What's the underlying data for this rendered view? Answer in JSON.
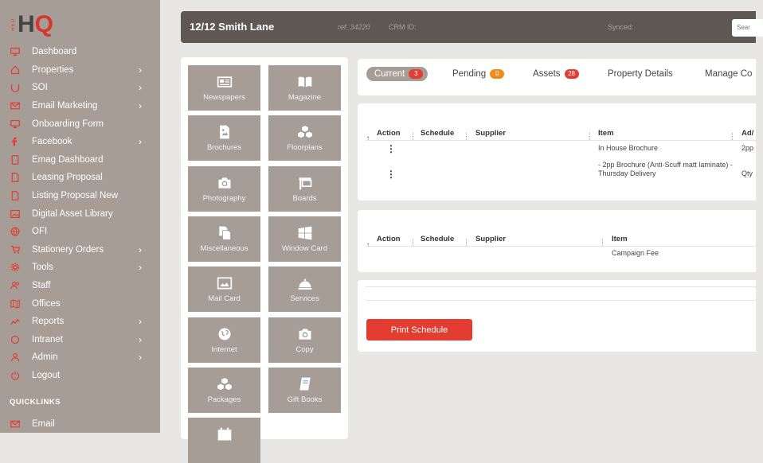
{
  "sidebar": {
    "logo_text_h": "H",
    "logo_text_q": "Q",
    "logo_mini": "RED",
    "items": [
      {
        "label": "Dashboard",
        "icon": "monitor-icon",
        "chevron": false
      },
      {
        "label": "Properties",
        "icon": "home-icon",
        "chevron": true
      },
      {
        "label": "SOI",
        "icon": "soi-icon",
        "chevron": true
      },
      {
        "label": "Email Marketing",
        "icon": "envelope-icon",
        "chevron": true
      },
      {
        "label": "Onboarding Form",
        "icon": "monitor-icon",
        "chevron": false
      },
      {
        "label": "Facebook",
        "icon": "facebook-icon",
        "chevron": true
      },
      {
        "label": "Emag Dashboard",
        "icon": "tablet-icon",
        "chevron": false
      },
      {
        "label": "Leasing Proposal",
        "icon": "file-icon",
        "chevron": false
      },
      {
        "label": "Listing Proposal New",
        "icon": "file-icon",
        "chevron": false
      },
      {
        "label": "Digital Asset Library",
        "icon": "image-icon",
        "chevron": false
      },
      {
        "label": "OFI",
        "icon": "globe-icon",
        "chevron": false
      },
      {
        "label": "Stationery Orders",
        "icon": "cart-icon",
        "chevron": true
      },
      {
        "label": "Tools",
        "icon": "gear-icon",
        "chevron": true
      },
      {
        "label": "Staff",
        "icon": "users-icon",
        "chevron": false
      },
      {
        "label": "Offices",
        "icon": "map-icon",
        "chevron": false
      },
      {
        "label": "Reports",
        "icon": "chart-icon",
        "chevron": true
      },
      {
        "label": "Intranet",
        "icon": "circle-icon",
        "chevron": true
      },
      {
        "label": "Admin",
        "icon": "user-icon",
        "chevron": true
      },
      {
        "label": "Logout",
        "icon": "power-icon",
        "chevron": false
      }
    ],
    "quicklinks_title": "QUICKLINKS",
    "quicklinks": [
      {
        "label": "Email",
        "icon": "envelope-icon"
      }
    ],
    "chevron_glyph": "›"
  },
  "header": {
    "address": "12/12 Smith Lane",
    "ref": "ref_34220",
    "crm_label": "CRM ID:",
    "synced_label": "Synced:",
    "search_placeholder": "Sear"
  },
  "tiles": [
    {
      "label": "Newspapers",
      "icon": "newspaper-icon"
    },
    {
      "label": "Magazine",
      "icon": "book-open-icon"
    },
    {
      "label": "Brochures",
      "icon": "brochure-icon"
    },
    {
      "label": "Floorplans",
      "icon": "cubes-icon"
    },
    {
      "label": "Photography",
      "icon": "camera-icon"
    },
    {
      "label": "Boards",
      "icon": "signboard-icon"
    },
    {
      "label": "Miscellaneous",
      "icon": "copy-icon"
    },
    {
      "label": "Window Card",
      "icon": "window-icon"
    },
    {
      "label": "Mail Card",
      "icon": "picture-icon"
    },
    {
      "label": "Services",
      "icon": "bell-icon"
    },
    {
      "label": "Internet",
      "icon": "globe-icon"
    },
    {
      "label": "Copy",
      "icon": "camera-icon"
    },
    {
      "label": "Packages",
      "icon": "cubes-icon"
    },
    {
      "label": "Gift Books",
      "icon": "notebook-icon"
    },
    {
      "label": "",
      "icon": "calendar-icon"
    }
  ],
  "tabs": [
    {
      "label": "Current",
      "count": "3",
      "badge": "red",
      "active": true
    },
    {
      "label": "Pending",
      "count": "0",
      "badge": "orange",
      "active": false
    },
    {
      "label": "Assets",
      "count": "28",
      "badge": "red",
      "active": false
    },
    {
      "label": "Property Details",
      "count": "",
      "badge": "",
      "active": false
    },
    {
      "label": "Manage Co",
      "count": "",
      "badge": "",
      "active": false
    }
  ],
  "table1": {
    "columns": [
      "Action",
      "Schedule",
      "Supplier",
      "Item",
      "Ad/"
    ],
    "rows": [
      {
        "item": "In House Brochure",
        "extra": "2pp"
      },
      {
        "item": "- 2pp Brochure (Anti-Scuff matt laminate) - Thursday Delivery",
        "extra": "Qty"
      }
    ]
  },
  "table2": {
    "columns": [
      "Action",
      "Schedule",
      "Supplier",
      "Item"
    ],
    "rows": [
      {
        "item": "Campaign Fee"
      }
    ]
  },
  "print_button": "Print Schedule",
  "colors": {
    "sidebar": "#a69d96",
    "accent": "#e33c30",
    "topbar": "#5f5753",
    "badge_orange": "#f08d1a"
  },
  "sort_glyph": "↑",
  "more_glyph": "⋮"
}
